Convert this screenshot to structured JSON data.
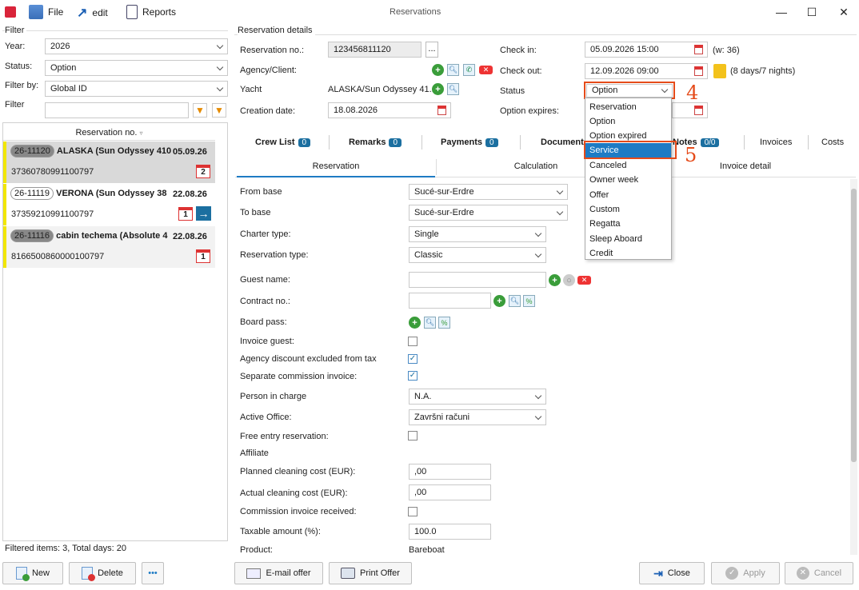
{
  "window": {
    "title": "Reservations",
    "menu": {
      "file": "File",
      "edit": "edit",
      "reports": "Reports"
    },
    "controls": {
      "minimize": "—",
      "maximize": "☐",
      "close": "✕"
    }
  },
  "filter": {
    "group_label": "Filter",
    "year_label": "Year:",
    "year_value": "2026",
    "status_label": "Status:",
    "status_value": "Option",
    "filterby_label": "Filter by:",
    "filterby_value": "Global ID",
    "filter_label": "Filter",
    "filter_value": ""
  },
  "list": {
    "column_header": "Reservation no.",
    "rows": [
      {
        "id": "26-11120",
        "title": "ALASKA (Sun Odyssey 410",
        "date": "05.09.26",
        "number": "37360780991100797",
        "day": "2"
      },
      {
        "id": "26-11119",
        "title": "VERONA (Sun Odyssey 38",
        "date": "22.08.26",
        "number": "37359210991100797",
        "day": "1"
      },
      {
        "id": "26-11116",
        "title": "cabin techema (Absolute 4",
        "date": "22.08.26",
        "number": "8166500860000100797",
        "day": "1"
      }
    ],
    "footer": "Filtered items: 3,  Total days: 20"
  },
  "details": {
    "group_label": "Reservation details",
    "resno_label": "Reservation no.:",
    "resno_value": "123456811120",
    "resno_more": "...",
    "agency_label": "Agency/Client:",
    "yacht_label": "Yacht",
    "yacht_value": "ALASKA/Sun Odyssey 41...",
    "creation_label": "Creation date:",
    "creation_value": "18.08.2026",
    "checkin_label": "Check in:",
    "checkin_value": "05.09.2026 15:00",
    "checkin_note": "(w: 36)",
    "checkout_label": "Check out:",
    "checkout_value": "12.09.2026 09:00",
    "checkout_note": "(8 days/7 nights)",
    "status_label": "Status",
    "status_value": "Option",
    "optexp_label": "Option expires:"
  },
  "status_dropdown": {
    "options": [
      "Reservation",
      "Option",
      "Option expired",
      "Service",
      "Canceled",
      "Owner week",
      "Offer",
      "Custom",
      "Regatta",
      "Sleep Aboard",
      "Credit"
    ],
    "selected": "Service"
  },
  "annotations": {
    "step4": "4",
    "step5": "5"
  },
  "tabs": {
    "crew": "Crew List",
    "crew_count": "0",
    "remarks": "Remarks",
    "remarks_count": "0",
    "payments": "Payments",
    "payments_count": "0",
    "documents": "Documents",
    "notes": "Notes",
    "notes_count": "0/0",
    "invoices": "Invoices",
    "costs": "Costs"
  },
  "subtabs": {
    "reservation": "Reservation",
    "calculation": "Calculation",
    "invoice_detail": "Invoice detail"
  },
  "form": {
    "from_base_label": "From base",
    "from_base_value": "Sucé-sur-Erdre",
    "to_base_label": "To base",
    "to_base_value": "Sucé-sur-Erdre",
    "charter_type_label": "Charter type:",
    "charter_type_value": "Single",
    "res_type_label": "Reservation type:",
    "res_type_value": "Classic",
    "guest_label": "Guest name:",
    "guest_value": "",
    "contract_label": "Contract no.:",
    "contract_value": "",
    "boardpass_label": "Board pass:",
    "invoice_guest_label": "Invoice guest:",
    "invoice_guest_checked": false,
    "agency_discount_label": "Agency discount excluded from tax",
    "agency_discount_checked": true,
    "sep_commission_label": "Separate commission invoice:",
    "sep_commission_checked": true,
    "person_label": "Person in charge",
    "person_value": "N.A.",
    "office_label": "Active Office:",
    "office_value": "Završni računi",
    "free_entry_label": "Free entry reservation:",
    "free_entry_checked": false,
    "affiliate_label": "Affiliate",
    "planned_clean_label": "Planned cleaning cost (EUR):",
    "planned_clean_value": ",00",
    "actual_clean_label": "Actual cleaning cost (EUR):",
    "actual_clean_value": ",00",
    "commission_recv_label": "Commission invoice received:",
    "commission_recv_checked": false,
    "taxable_label": "Taxable amount (%):",
    "taxable_value": "100.0",
    "product_label": "Product:",
    "product_value": "Bareboat"
  },
  "buttons": {
    "new": "New",
    "delete": "Delete",
    "more": "•••",
    "email_offer": "E-mail offer",
    "print_offer": "Print Offer",
    "close": "Close",
    "apply": "Apply",
    "cancel": "Cancel"
  },
  "colors": {
    "accent": "#1e7bc4",
    "annotation": "#e54b1a",
    "yellow_marker": "#f1e600",
    "badge": "#1b6fa0"
  }
}
